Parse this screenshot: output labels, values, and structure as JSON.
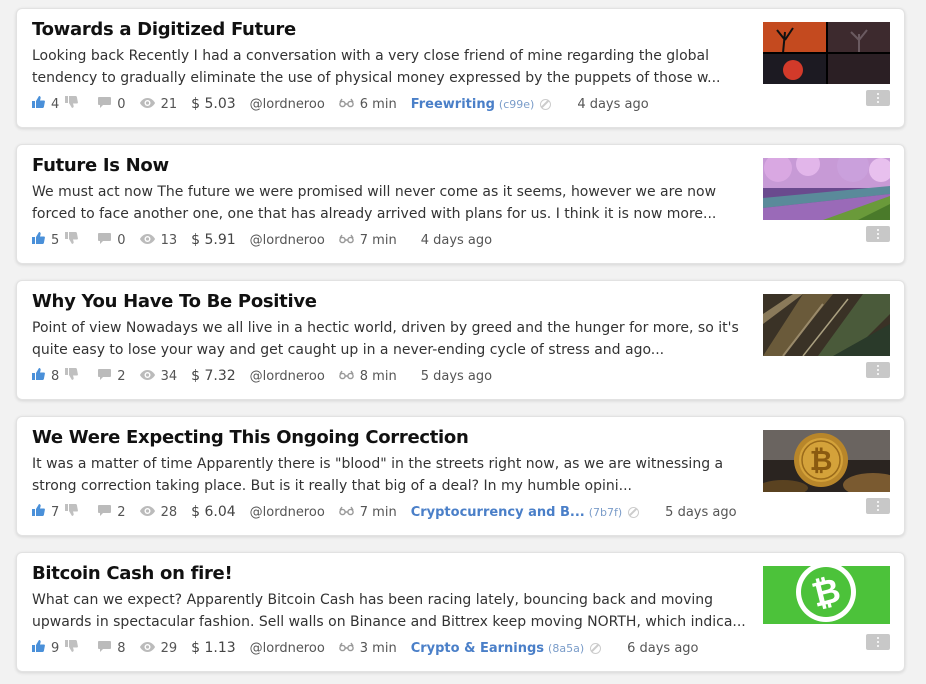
{
  "colors": {
    "accent": "#4a7fc8",
    "upvote": "#4a90d9"
  },
  "posts": [
    {
      "title": "Towards a Digitized Future",
      "excerpt": "Looking back Recently I had a conversation with a very close friend of mine regarding the global tendency to gradually eliminate the use of physical money expressed by the puppets of those w...",
      "votes": "4",
      "comments": "0",
      "views": "21",
      "payout": "$ 5.03",
      "author": "@lordneroo",
      "read_time": "6 min",
      "tag": "Freewriting",
      "tag_code": "(c99e)",
      "age": "4 days ago"
    },
    {
      "title": "Future Is Now",
      "excerpt": "We must act now The future we were promised will never come as it seems, however we are now forced to face another one, one that has already arrived with plans for us. I think it is now more...",
      "votes": "5",
      "comments": "0",
      "views": "13",
      "payout": "$ 5.91",
      "author": "@lordneroo",
      "read_time": "7 min",
      "tag": "",
      "tag_code": "",
      "age": "4 days ago"
    },
    {
      "title": "Why You Have To Be Positive",
      "excerpt": "Point of view Nowadays we all live in a hectic world, driven by greed and the hunger for more, so it's quite easy to lose your way and get caught up in a never-ending cycle of stress and ago...",
      "votes": "8",
      "comments": "2",
      "views": "34",
      "payout": "$ 7.32",
      "author": "@lordneroo",
      "read_time": "8 min",
      "tag": "",
      "tag_code": "",
      "age": "5 days ago"
    },
    {
      "title": "We Were Expecting This Ongoing Correction",
      "excerpt": "It was a matter of time Apparently there is \"blood\" in the streets right now, as we are witnessing a strong correction taking place. But is it really that big of a deal? In my humble opini...",
      "votes": "7",
      "comments": "2",
      "views": "28",
      "payout": "$ 6.04",
      "author": "@lordneroo",
      "read_time": "7 min",
      "tag": "Cryptocurrency and B...",
      "tag_code": "(7b7f)",
      "age": "5 days ago"
    },
    {
      "title": "Bitcoin Cash on fire!",
      "excerpt": "What can we expect? Apparently Bitcoin Cash has been racing lately, bouncing back and moving upwards in spectacular fashion. Sell walls on Binance and Bittrex keep moving NORTH, which indica...",
      "votes": "9",
      "comments": "8",
      "views": "29",
      "payout": "$ 1.13",
      "author": "@lordneroo",
      "read_time": "3 min",
      "tag": "Crypto & Earnings",
      "tag_code": "(8a5a)",
      "age": "6 days ago"
    }
  ]
}
